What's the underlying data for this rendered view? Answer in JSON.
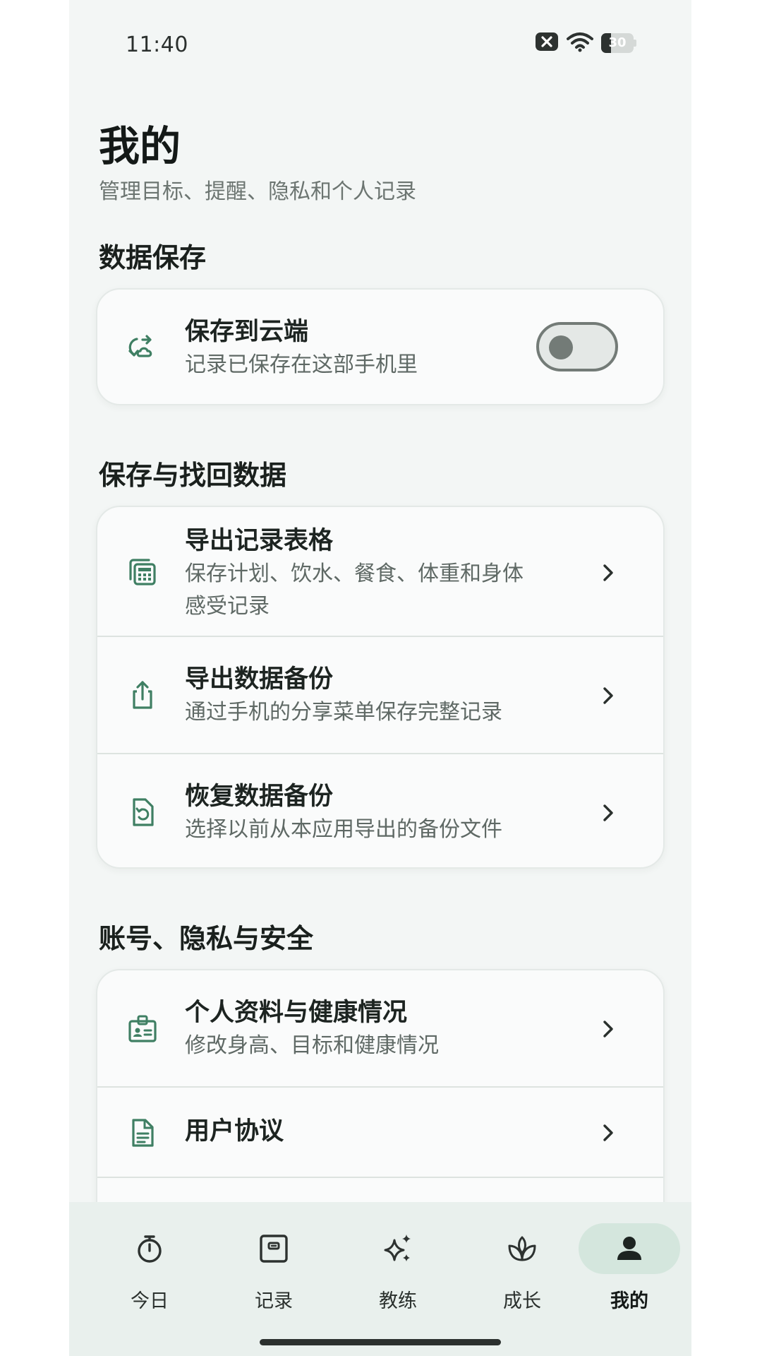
{
  "status_bar": {
    "time": "11:40",
    "battery_level": "30",
    "battery_fraction": 0.3,
    "icons": [
      "notification-blocked-icon",
      "wifi-icon",
      "battery-icon"
    ]
  },
  "header": {
    "title": "我的",
    "subtitle": "管理目标、提醒、隐私和个人记录"
  },
  "sections": {
    "data_save": {
      "title": "数据保存",
      "cloud": {
        "title": "保存到云端",
        "desc": "记录已保存在这部手机里",
        "enabled": false,
        "icon": "cloud-sync-icon"
      }
    },
    "backup": {
      "title": "保存与找回数据",
      "items": [
        {
          "title": "导出记录表格",
          "desc_line1": "保存计划、饮水、餐食、体重和身体",
          "desc_line2": "感受记录",
          "icon": "spreadsheet-icon"
        },
        {
          "title": "导出数据备份",
          "desc": "通过手机的分享菜单保存完整记录",
          "icon": "share-icon"
        },
        {
          "title": "恢复数据备份",
          "desc": "选择以前从本应用导出的备份文件",
          "icon": "restore-file-icon"
        }
      ]
    },
    "account": {
      "title": "账号、隐私与安全",
      "items": [
        {
          "title": "个人资料与健康情况",
          "desc": "修改身高、目标和健康情况",
          "icon": "id-badge-icon"
        },
        {
          "title": "用户协议",
          "icon": "document-icon"
        }
      ]
    }
  },
  "bottom_nav": {
    "active": "mine",
    "items": [
      {
        "key": "today",
        "label": "今日",
        "icon": "stopwatch-icon"
      },
      {
        "key": "record",
        "label": "记录",
        "icon": "record-icon"
      },
      {
        "key": "coach",
        "label": "教练",
        "icon": "sparkle-icon"
      },
      {
        "key": "growth",
        "label": "成长",
        "icon": "sprout-icon"
      },
      {
        "key": "mine",
        "label": "我的",
        "icon": "person-icon"
      }
    ]
  },
  "colors": {
    "accent": "#3f7f63",
    "background": "#f3f6f5",
    "card": "#fafbfb",
    "nav_background": "#e9f0ed",
    "nav_active_pill": "#d4e6dd",
    "text_primary": "#1d2421",
    "text_secondary": "#5f6965"
  }
}
